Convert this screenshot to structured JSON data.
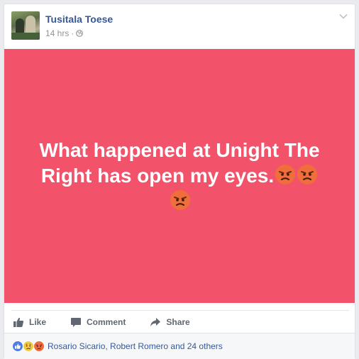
{
  "post": {
    "author": "Tusitala Toese",
    "time": "14 hrs",
    "separator": "·",
    "text": "What happened at Unight The Right has open my eyes."
  },
  "actions": {
    "like": "Like",
    "comment": "Comment",
    "share": "Share"
  },
  "reactions": {
    "summary": "Rosario Sicario, Robert Romero and 24 others",
    "icons": [
      "like-reaction-icon",
      "sad-reaction-icon",
      "angry-reaction-icon"
    ]
  },
  "colors": {
    "banner": "#f2526a",
    "link": "#365899",
    "meta": "#90949c",
    "action": "#606770"
  },
  "emoji": [
    "angry-face-icon",
    "angry-face-icon",
    "angry-face-icon"
  ]
}
